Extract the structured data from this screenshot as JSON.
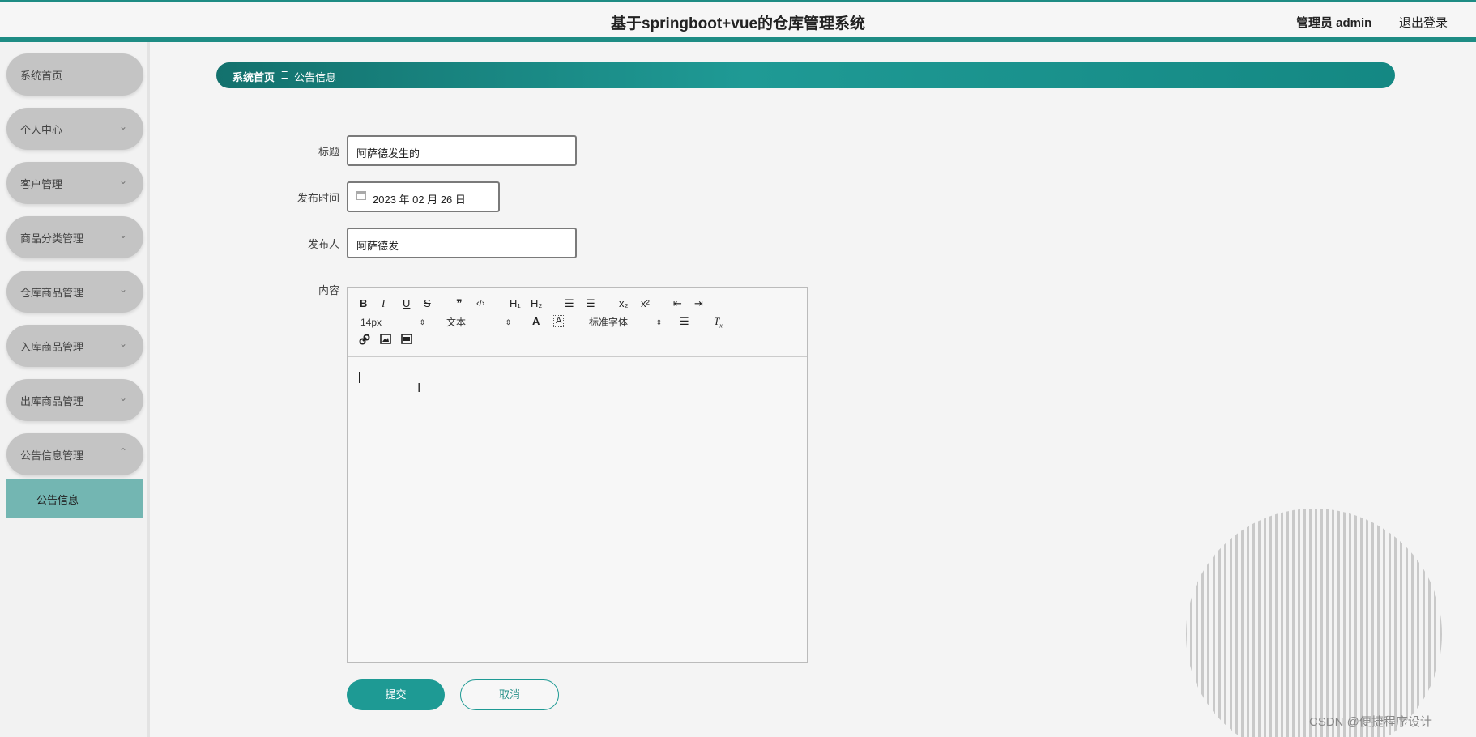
{
  "header": {
    "title": "基于springboot+vue的仓库管理系统",
    "user_label": "管理员 admin",
    "logout_label": "退出登录"
  },
  "sidebar": {
    "items": [
      {
        "label": "系统首页",
        "chevron": ""
      },
      {
        "label": "个人中心",
        "chevron": "⌄"
      },
      {
        "label": "客户管理",
        "chevron": "⌄"
      },
      {
        "label": "商品分类管理",
        "chevron": "⌄"
      },
      {
        "label": "仓库商品管理",
        "chevron": "⌄"
      },
      {
        "label": "入库商品管理",
        "chevron": "⌄"
      },
      {
        "label": "出库商品管理",
        "chevron": "⌄"
      },
      {
        "label": "公告信息管理",
        "chevron": "⌃"
      }
    ],
    "sub_item": "公告信息"
  },
  "breadcrumb": {
    "home": "系统首页",
    "separator": "Ξ",
    "current": "公告信息"
  },
  "form": {
    "title_label": "标题",
    "title_value": "阿萨德发生的",
    "time_label": "发布时间",
    "time_value": "2023 年 02 月 26 日",
    "publisher_label": "发布人",
    "publisher_value": "阿萨德发",
    "content_label": "内容"
  },
  "editor": {
    "toolbar_row1": [
      "B",
      "I",
      "U",
      "S",
      "❞",
      "‹/›",
      "H₁",
      "H₂",
      "☰",
      "☰",
      "x₂",
      "x²",
      "⇤",
      "⇥"
    ],
    "font_size": "14px",
    "block_format": "文本",
    "font_family": "标准字体"
  },
  "actions": {
    "submit": "提交",
    "cancel": "取消"
  },
  "watermark": "CSDN @便捷程序设计",
  "colors": {
    "accent": "#1e9a94",
    "menu_bg": "#c4c4c4",
    "submenu_bg": "#73b6b2"
  }
}
